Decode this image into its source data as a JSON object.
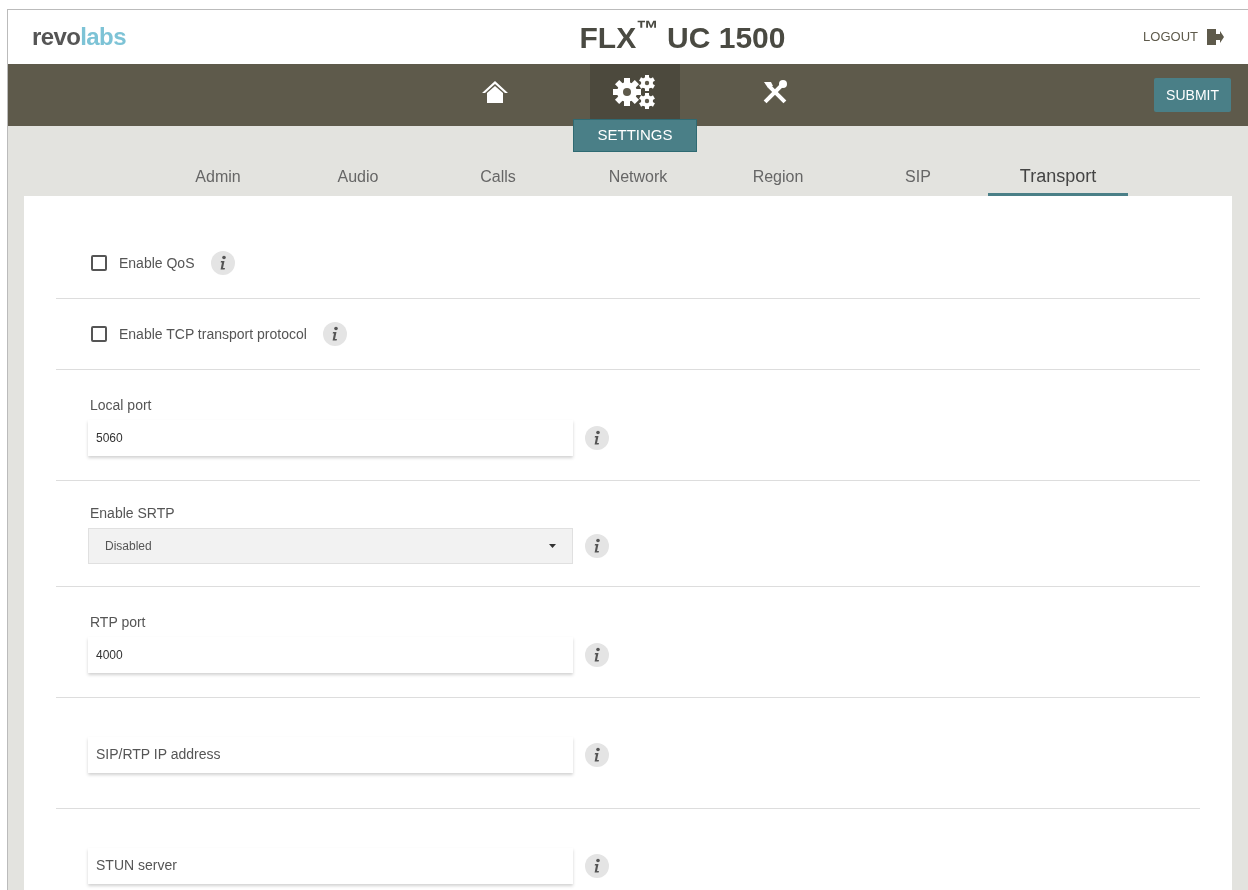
{
  "header": {
    "logo": {
      "part_1": "revo",
      "part_2": "labs"
    },
    "title": "**FLX**$^{™}$ UC 1500",
    "logout": "LOGOUT"
  },
  "nav": [
    {
      "kind": "home",
      "selected": false
    },
    {
      "kind": "settings",
      "selected": true,
      "label": "SETTINGS"
    },
    {
      "kind": "tools",
      "selected": false
    }
  ],
  "submit": "SUBMIT",
  "tabs": [
    {
      "label": "Admin",
      "selected": false
    },
    {
      "label": "Audio",
      "selected": false
    },
    {
      "label": "Calls",
      "selected": false
    },
    {
      "label": "Network",
      "selected": false
    },
    {
      "label": "Region",
      "selected": false
    },
    {
      "label": "SIP",
      "selected": false
    },
    {
      "label": "Transport",
      "selected": true
    }
  ],
  "rows": [
    {
      "kind": "checkbox",
      "label": "Enable QoS",
      "checked": false
    },
    {
      "kind": "checkbox",
      "label": "Enable TCP transport protocol",
      "checked": false
    },
    {
      "kind": "input",
      "label": "Local port",
      "value": "5060"
    },
    {
      "kind": "select",
      "label": "Enable SRTP",
      "value": "Disabled"
    },
    {
      "kind": "input",
      "label": "RTP port",
      "value": "4000"
    },
    {
      "kind": "input",
      "placeholder": "SIP/RTP IP address"
    },
    {
      "kind": "input",
      "placeholder": "STUN server"
    }
  ]
}
